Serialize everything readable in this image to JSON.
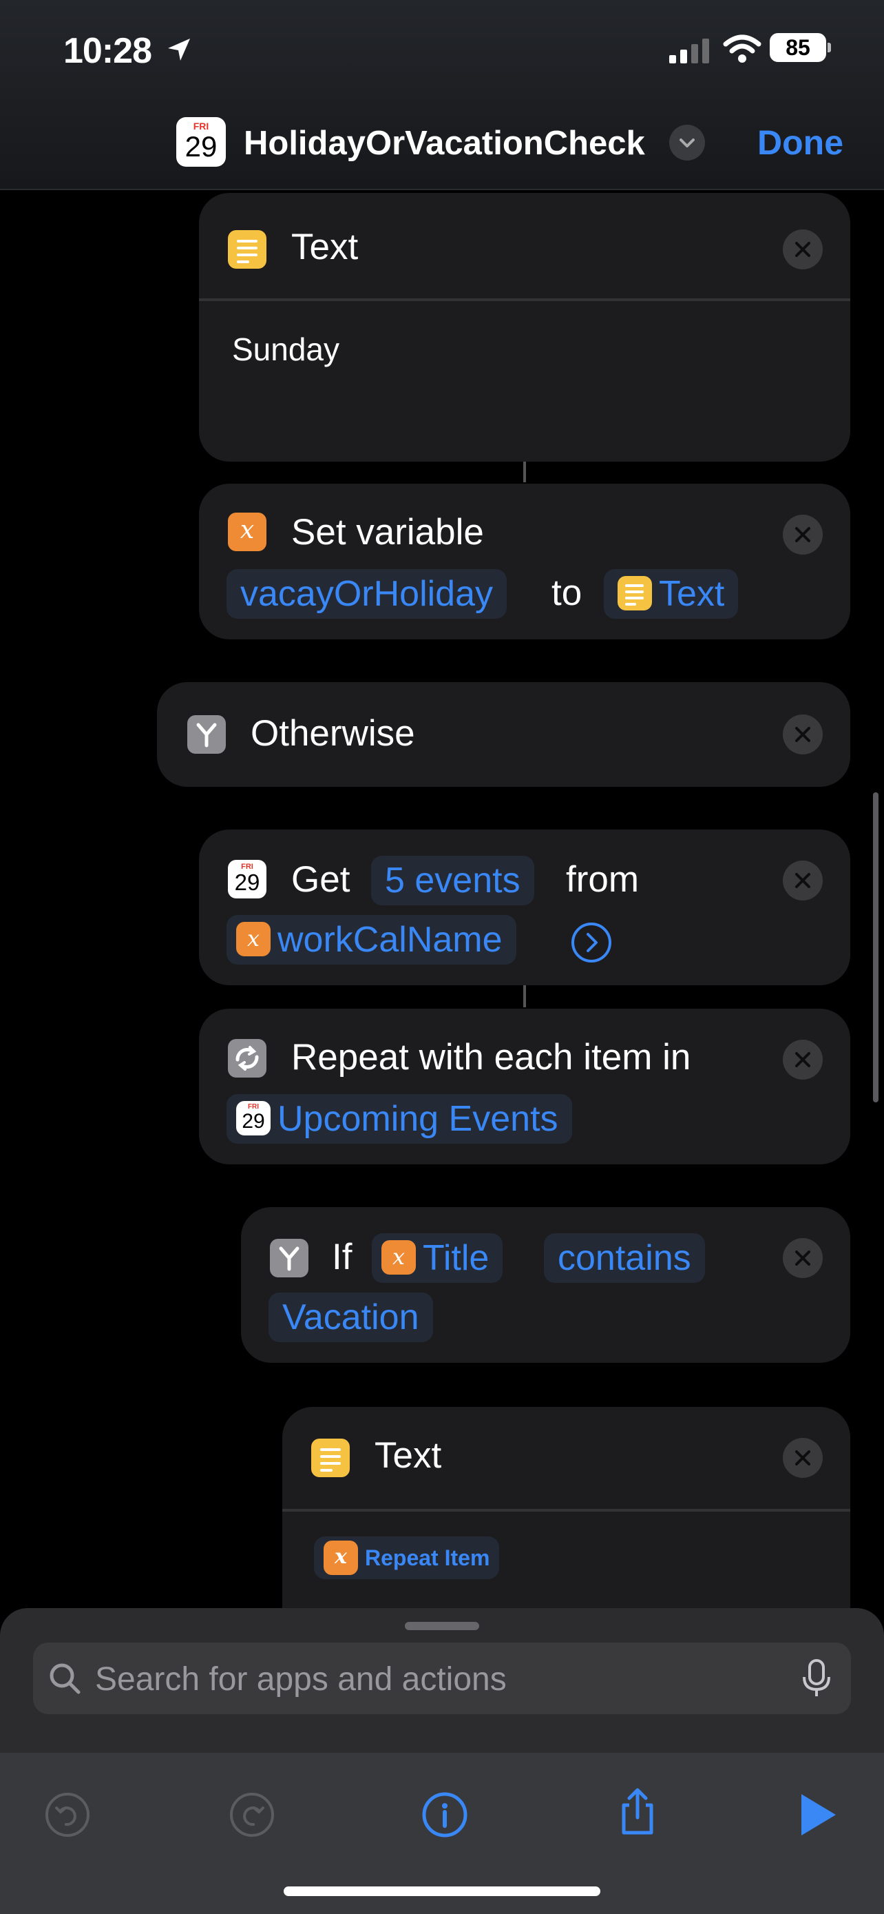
{
  "status_bar": {
    "time": "10:28",
    "battery": "85"
  },
  "nav": {
    "cal_month": "FRI",
    "cal_day": "29",
    "title": "HolidayOrVacationCheck",
    "done_label": "Done"
  },
  "actions": {
    "text1": {
      "title": "Text",
      "content": "Sunday"
    },
    "set_variable": {
      "title": "Set variable",
      "variable": "vacayOrHoliday",
      "to": "to",
      "value": "Text"
    },
    "otherwise": {
      "title": "Otherwise"
    },
    "get_events": {
      "get": "Get",
      "count": "5 events",
      "from": "from",
      "calendar": "workCalName"
    },
    "repeat": {
      "title": "Repeat with each item in",
      "source": "Upcoming Events"
    },
    "if": {
      "if": "If",
      "field": "Title",
      "condition": "contains",
      "value": "Vacation"
    },
    "text2": {
      "title": "Text",
      "content": "Repeat Item"
    }
  },
  "search": {
    "placeholder": "Search for apps and actions"
  },
  "icons": {
    "text": "text-lines-icon",
    "variable": "variable-x-icon",
    "branch": "branch-icon",
    "calendar": "calendar-icon",
    "repeat": "repeat-icon"
  },
  "colors": {
    "accent": "#3a87f6",
    "text_action": "#f6c242",
    "variable": "#ef8b35",
    "card": "#1c1c1e"
  }
}
